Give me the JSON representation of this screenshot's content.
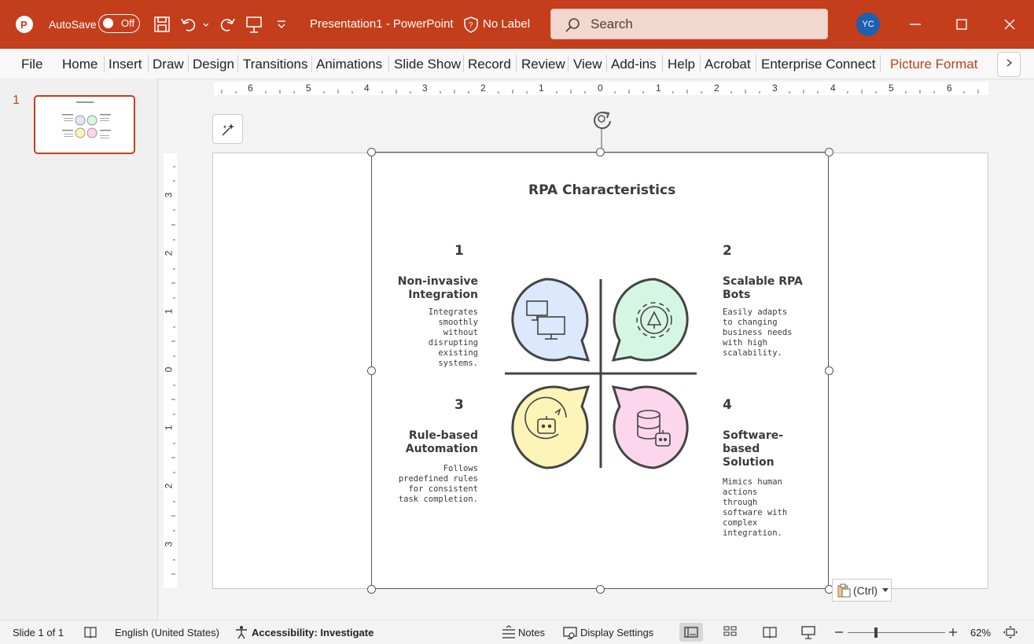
{
  "titlebar": {
    "autosave_label": "AutoSave",
    "autosave_state": "Off",
    "doc_title": "Presentation1  -  PowerPoint",
    "sensitivity_label": "No Label",
    "search_placeholder": "Search",
    "avatar_initials": "YC"
  },
  "ribbon": {
    "tabs": [
      "File",
      "Home",
      "Insert",
      "Draw",
      "Design",
      "Transitions",
      "Animations",
      "Slide Show",
      "Record",
      "Review",
      "View",
      "Add-ins",
      "Help",
      "Acrobat",
      "Enterprise Connect",
      "Picture Format"
    ],
    "active_tab": "Picture Format"
  },
  "thumbnails": {
    "slide_number": "1"
  },
  "rulers": {
    "horizontal": [
      "6",
      "5",
      "4",
      "3",
      "2",
      "1",
      "0",
      "1",
      "2",
      "3",
      "4",
      "5",
      "6"
    ],
    "vertical": [
      "3",
      "2",
      "1",
      "0",
      "1",
      "2",
      "3"
    ]
  },
  "slide": {
    "title": "RPA Characteristics",
    "items": [
      {
        "number": "1",
        "heading": "Non-invasive Integration",
        "description": "Integrates smoothly without disrupting existing systems.",
        "color": "#dce8fb"
      },
      {
        "number": "2",
        "heading": "Scalable RPA Bots",
        "description": "Easily adapts to changing business needs with high scalability.",
        "color": "#d6f6e4"
      },
      {
        "number": "3",
        "heading": "Rule-based Automation",
        "description": "Follows predefined rules for consistent task completion.",
        "color": "#fdf5b8"
      },
      {
        "number": "4",
        "heading": "Software-based Solution",
        "description": "Mimics human actions through software with complex integration.",
        "color": "#fbd6ec"
      }
    ]
  },
  "paste_options": {
    "label": "(Ctrl)"
  },
  "statusbar": {
    "slide_info": "Slide 1 of 1",
    "language": "English (United States)",
    "accessibility": "Accessibility: Investigate",
    "notes": "Notes",
    "display_settings": "Display Settings",
    "zoom": "62%",
    "zoom_level": 0.62
  },
  "colors": {
    "accent": "#c43e1c"
  }
}
